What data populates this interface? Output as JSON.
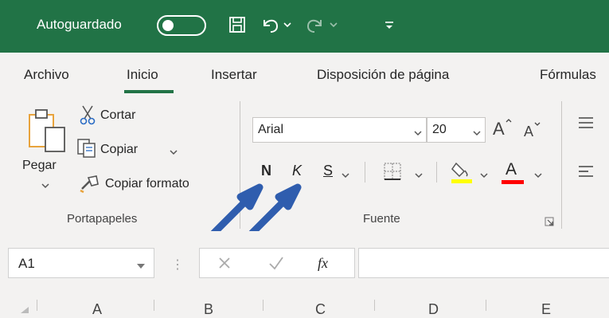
{
  "titlebar": {
    "autosave_label": "Autoguardado",
    "colors": {
      "bar": "#217346",
      "text": "#ffffff"
    },
    "icons": [
      "toggle-off-icon",
      "save-icon",
      "undo-icon",
      "chevron-down-icon",
      "redo-icon",
      "customize-qat-icon"
    ]
  },
  "tabs": [
    {
      "label": "Archivo"
    },
    {
      "label": "Inicio",
      "active": true
    },
    {
      "label": "Insertar"
    },
    {
      "label": "Disposición de página"
    },
    {
      "label": "Fórmulas"
    }
  ],
  "clipboard": {
    "paste_label": "Pegar",
    "cut_label": "Cortar",
    "copy_label": "Copiar",
    "format_painter_label": "Copiar formato",
    "group_label": "Portapapeles"
  },
  "font": {
    "font_name": "Arial",
    "font_size": "20",
    "bold_label": "N",
    "italic_label": "K",
    "underline_label": "S",
    "font_color_label": "A",
    "group_label": "Fuente",
    "colors": {
      "highlight": "#ffff00",
      "font_color": "#ff0000",
      "arrow": "#2f5dae"
    }
  },
  "formula_bar": {
    "name_box": "A1",
    "fx_label": "fx"
  },
  "columns": [
    "A",
    "B",
    "C",
    "D",
    "E"
  ]
}
